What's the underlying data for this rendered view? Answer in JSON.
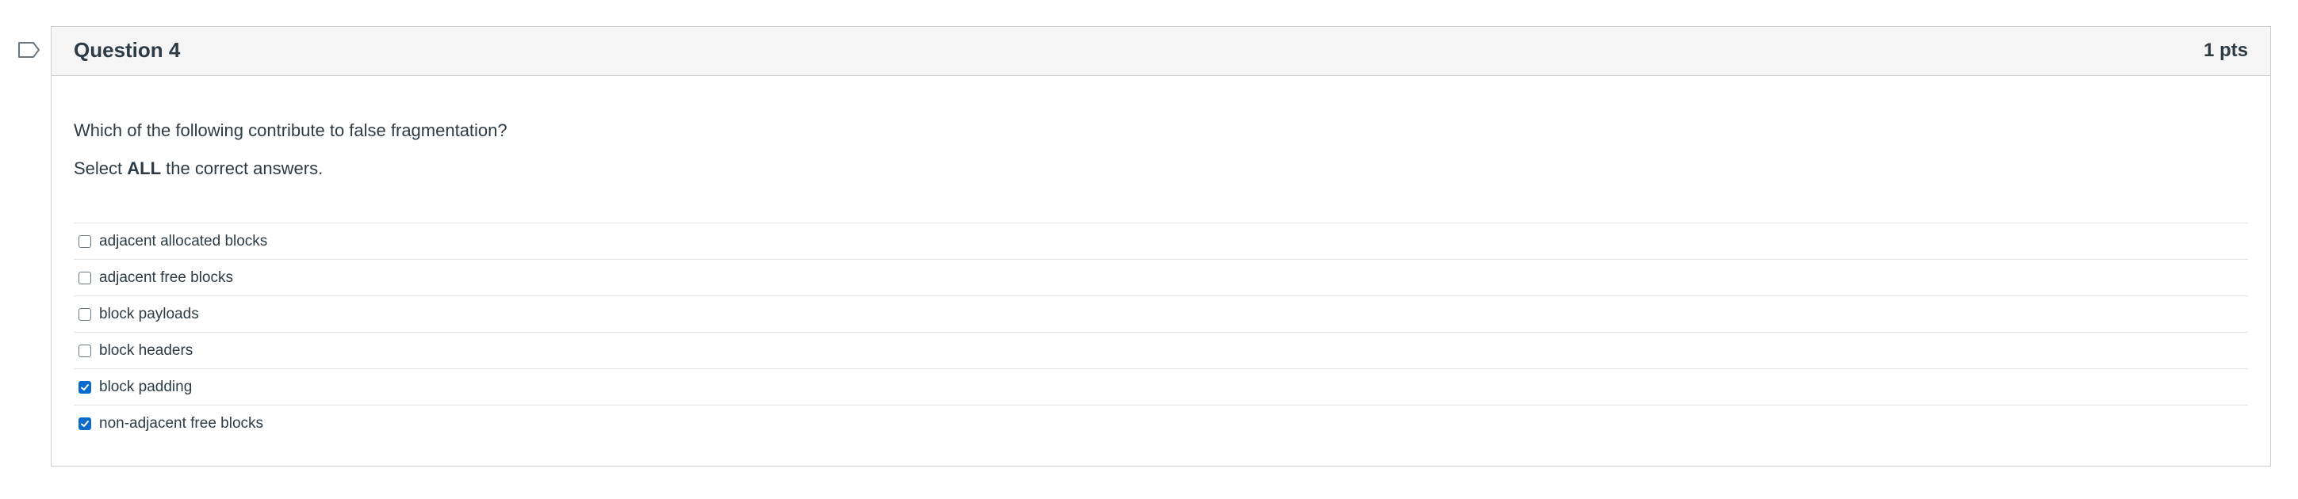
{
  "question": {
    "title": "Question 4",
    "points": "1 pts",
    "prompt_line1": "Which of the following contribute to false fragmentation?",
    "prompt_line2_prefix": "Select ",
    "prompt_line2_bold": "ALL",
    "prompt_line2_suffix": " the correct answers.",
    "answers": [
      {
        "label": "adjacent allocated blocks",
        "checked": false
      },
      {
        "label": "adjacent free blocks",
        "checked": false
      },
      {
        "label": "block payloads",
        "checked": false
      },
      {
        "label": "block headers",
        "checked": false
      },
      {
        "label": "block padding",
        "checked": true
      },
      {
        "label": "non-adjacent free blocks",
        "checked": true
      }
    ]
  },
  "colors": {
    "accent": "#0b6bcb",
    "header_bg": "#f5f5f5",
    "border": "#c7cdd1",
    "text": "#2d3b45"
  },
  "icons": {
    "flag": "bookmark-flag-icon",
    "check": "checkmark-icon"
  }
}
